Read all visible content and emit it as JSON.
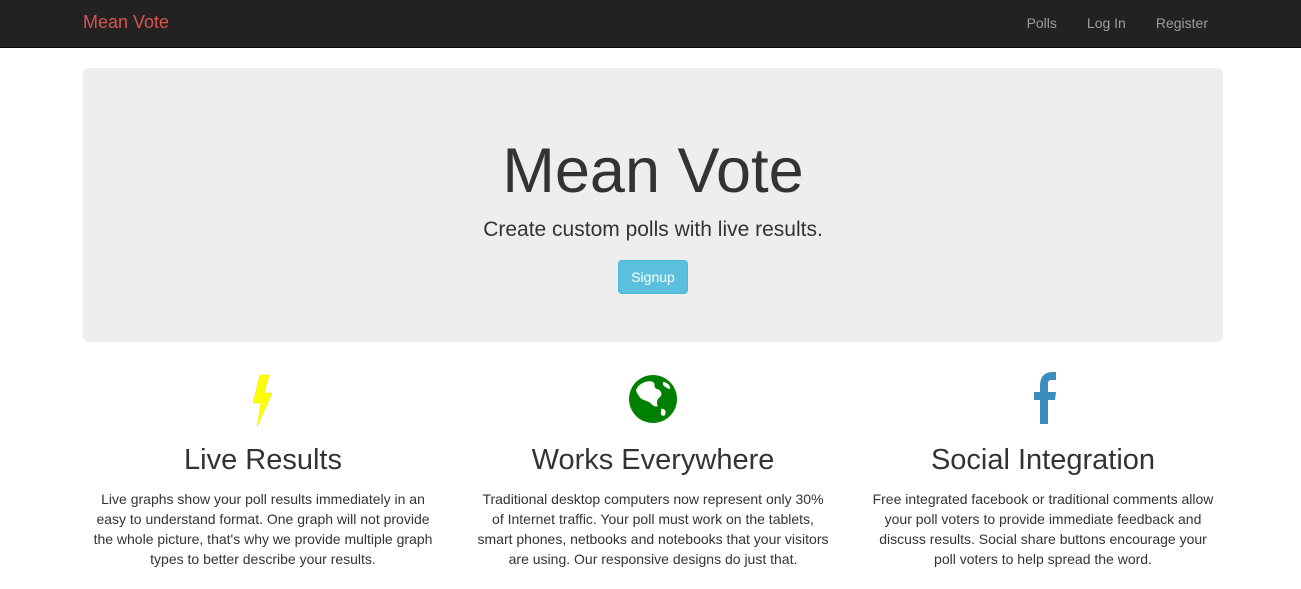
{
  "navbar": {
    "brand": "Mean Vote",
    "links": [
      "Polls",
      "Log In",
      "Register"
    ]
  },
  "jumbotron": {
    "title": "Mean Vote",
    "lead": "Create custom polls with live results.",
    "button_label": "Signup"
  },
  "features": [
    {
      "icon": "lightning-bolt-icon",
      "title": "Live Results",
      "text": "Live graphs show your poll results immediately in an easy to understand format. One graph will not provide the whole picture, that's why we provide multiple graph types to better describe your results."
    },
    {
      "icon": "globe-icon",
      "title": "Works Everywhere",
      "text": "Traditional desktop computers now represent only 30% of Internet traffic. Your poll must work on the tablets, smart phones, netbooks and notebooks that your visitors are using. Our responsive designs do just that."
    },
    {
      "icon": "facebook-icon",
      "title": "Social Integration",
      "text": "Free integrated facebook or traditional comments allow your poll voters to provide immediate feedback and discuss results. Social share buttons encourage your poll voters to help spread the word."
    }
  ],
  "colors": {
    "brand": "#d9534f",
    "navbar_bg": "#222222",
    "jumbotron_bg": "#eeeeee",
    "button": "#5bc0de",
    "lightning": "#ffff00",
    "globe": "#008000",
    "facebook": "#3b8dbd"
  }
}
